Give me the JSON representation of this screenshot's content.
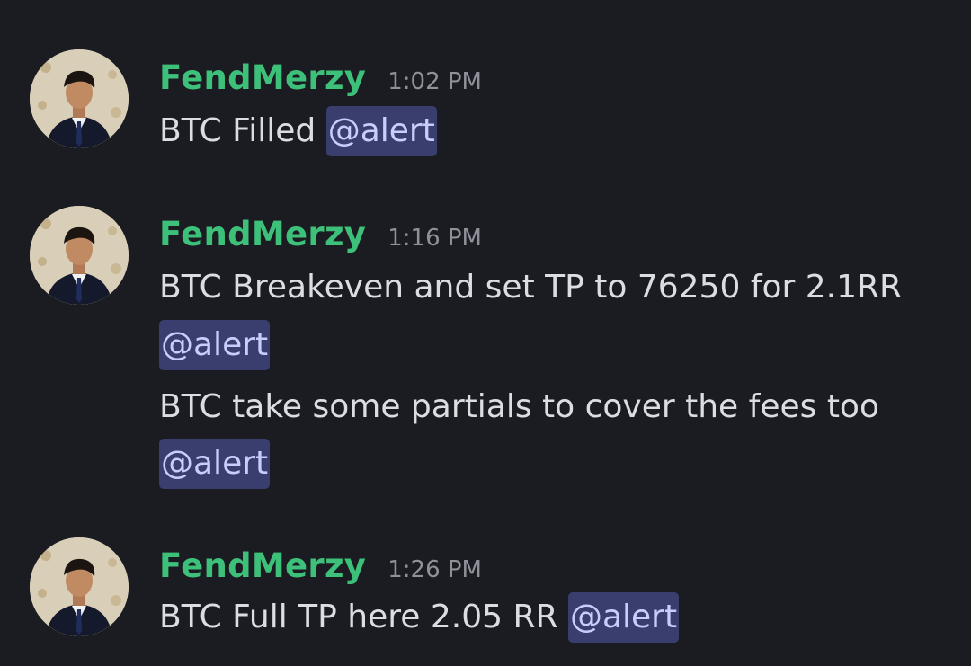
{
  "messages": [
    {
      "username": "FendMerzy",
      "timestamp": "1:02 PM",
      "lines": [
        {
          "text": "BTC Filled ",
          "mention": "@alert"
        }
      ]
    },
    {
      "username": "FendMerzy",
      "timestamp": "1:16 PM",
      "lines": [
        {
          "text": "BTC Breakeven and set TP to 76250 for 2.1RR",
          "mention": ""
        },
        {
          "text": "",
          "mention": "@alert"
        },
        {
          "text": "BTC take some partials to cover the fees too",
          "mention": ""
        },
        {
          "text": "",
          "mention": "@alert"
        }
      ]
    },
    {
      "username": "FendMerzy",
      "timestamp": "1:26 PM",
      "lines": [
        {
          "text": "BTC Full TP here 2.05 RR ",
          "mention": "@alert"
        }
      ]
    }
  ],
  "colors": {
    "background": "#1b1c21",
    "username": "#3dc17a",
    "timestamp": "#8f919a",
    "text": "#dcdde2",
    "mention_bg": "#3a3e6e",
    "mention_text": "#c9cdfb"
  },
  "icons": {
    "avatar": "user-avatar-photo"
  }
}
